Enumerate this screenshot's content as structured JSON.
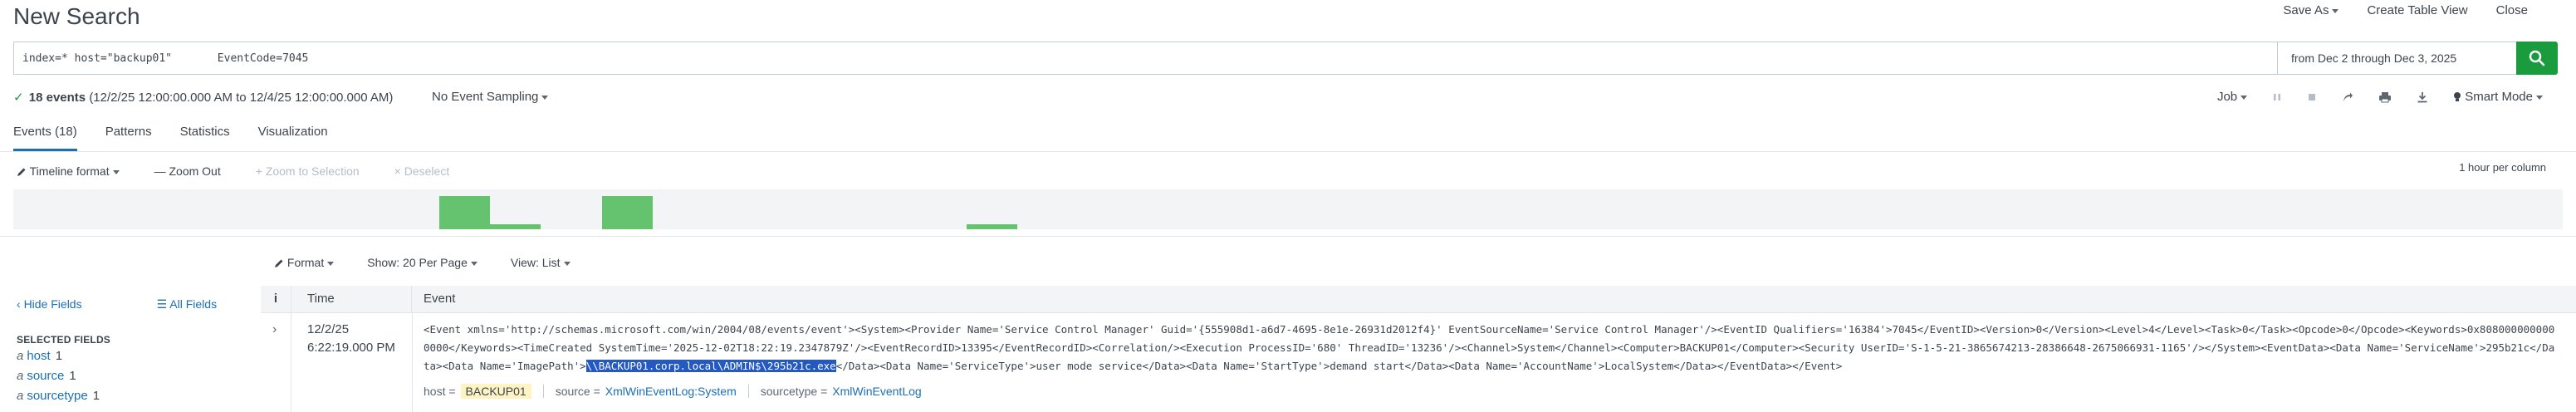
{
  "header": {
    "title": "New Search",
    "save_as": "Save As",
    "create_table_view": "Create Table View",
    "close": "Close"
  },
  "search": {
    "query": "index=* host=\"backup01\"       EventCode=7045",
    "time_range": "from Dec 2 through Dec 3, 2025"
  },
  "status": {
    "events_count": "18 events",
    "range": "(12/2/25 12:00:00.000 AM to 12/4/25 12:00:00.000 AM)",
    "sampling": "No Event Sampling",
    "job": "Job",
    "mode": "Smart Mode"
  },
  "tabs": [
    {
      "label": "Events (18)"
    },
    {
      "label": "Patterns"
    },
    {
      "label": "Statistics"
    },
    {
      "label": "Visualization"
    }
  ],
  "timeline_toolbar": {
    "format": "Timeline format",
    "zoom_out": "Zoom Out",
    "zoom_selection": "Zoom to Selection",
    "deselect": "Deselect",
    "per_column": "1 hour per column"
  },
  "timeline_bars": [
    {
      "start": 0.167,
      "end": 0.187,
      "level": 1.0
    },
    {
      "start": 0.187,
      "end": 0.207,
      "level": 0.15
    },
    {
      "start": 0.231,
      "end": 0.251,
      "level": 1.0
    },
    {
      "start": 0.374,
      "end": 0.394,
      "level": 0.15
    }
  ],
  "results_toolbar": {
    "format": "Format",
    "per_page": "Show: 20 Per Page",
    "view": "View: List"
  },
  "left_panel": {
    "hide_fields": "Hide Fields",
    "all_fields": "All Fields",
    "selected_heading": "SELECTED FIELDS",
    "fields": [
      {
        "type": "a",
        "name": "host",
        "count": "1"
      },
      {
        "type": "a",
        "name": "source",
        "count": "1"
      },
      {
        "type": "a",
        "name": "sourcetype",
        "count": "1"
      }
    ]
  },
  "table": {
    "col_info": "i",
    "col_time": "Time",
    "col_event": "Event",
    "row": {
      "date": "12/2/25",
      "time": "6:22:19.000 PM",
      "event_before": "<Event xmlns='http://schemas.microsoft.com/win/2004/08/events/event'><System><Provider Name='Service Control Manager' Guid='{555908d1-a6d7-4695-8e1e-26931d2012f4}' EventSourceName='Service Control Manager'/><EventID Qualifiers='16384'>7045</EventID><Version>0</Version><Level>4</Level><Task>0</Task><Opcode>0</Opcode><Keywords>0x8080000000000000</Keywords><TimeCreated SystemTime='2025-12-02T18:22:19.2347879Z'/><EventRecordID>13395</EventRecordID><Correlation/><Execution ProcessID='680' ThreadID='13236'/><Channel>System</Channel><Computer>BACKUP01</Computer><Security UserID='S-1-5-21-3865674213-28386648-2675066931-1165'/></System><EventData><Data Name='ServiceName'>295b21c</Data><Data Name='ImagePath'>",
      "event_highlight": "\\\\BACKUP01.corp.local\\ADMIN$\\295b21c.exe",
      "event_after": "</Data><Data Name='ServiceType'>user mode service</Data><Data Name='StartType'>demand start</Data><Data Name='AccountName'>LocalSystem</Data></EventData></Event>",
      "fields": {
        "host_key": "host =",
        "host_val": "BACKUP01",
        "source_key": "source =",
        "source_val": "XmlWinEventLog:System",
        "sourcetype_key": "sourcetype =",
        "sourcetype_val": "XmlWinEventLog"
      }
    }
  },
  "colors": {
    "accent": "#1a6fb5",
    "search_button": "#1a9c3e",
    "timeline_bar": "#65c26e",
    "highlight": "#2459c2"
  }
}
